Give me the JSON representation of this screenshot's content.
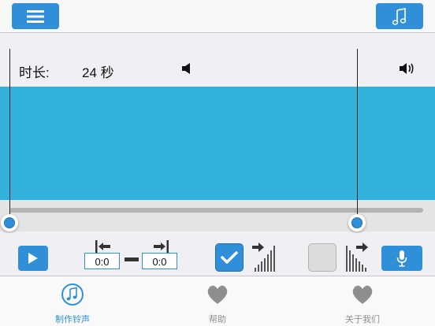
{
  "toolbar": {
    "menu_icon": "menu-icon",
    "music_icon": "music-note-icon"
  },
  "info": {
    "duration_label": "时长:",
    "duration_value": "24 秒",
    "volume_low_icon": "volume-low-icon",
    "volume_high_icon": "volume-high-icon"
  },
  "controls": {
    "start_time": "0:0",
    "end_time": "0:0",
    "fade_in_checked": true,
    "fade_out_checked": false
  },
  "tabs": [
    {
      "label": "制作铃声",
      "icon": "music-note-circle-icon",
      "active": true
    },
    {
      "label": "帮助",
      "icon": "heart-icon",
      "active": false
    },
    {
      "label": "关于我们",
      "icon": "heart-icon",
      "active": false
    }
  ],
  "colors": {
    "accent": "#2f8fd8",
    "waveform": "#32b1db",
    "inactive": "#8e8e8e"
  }
}
